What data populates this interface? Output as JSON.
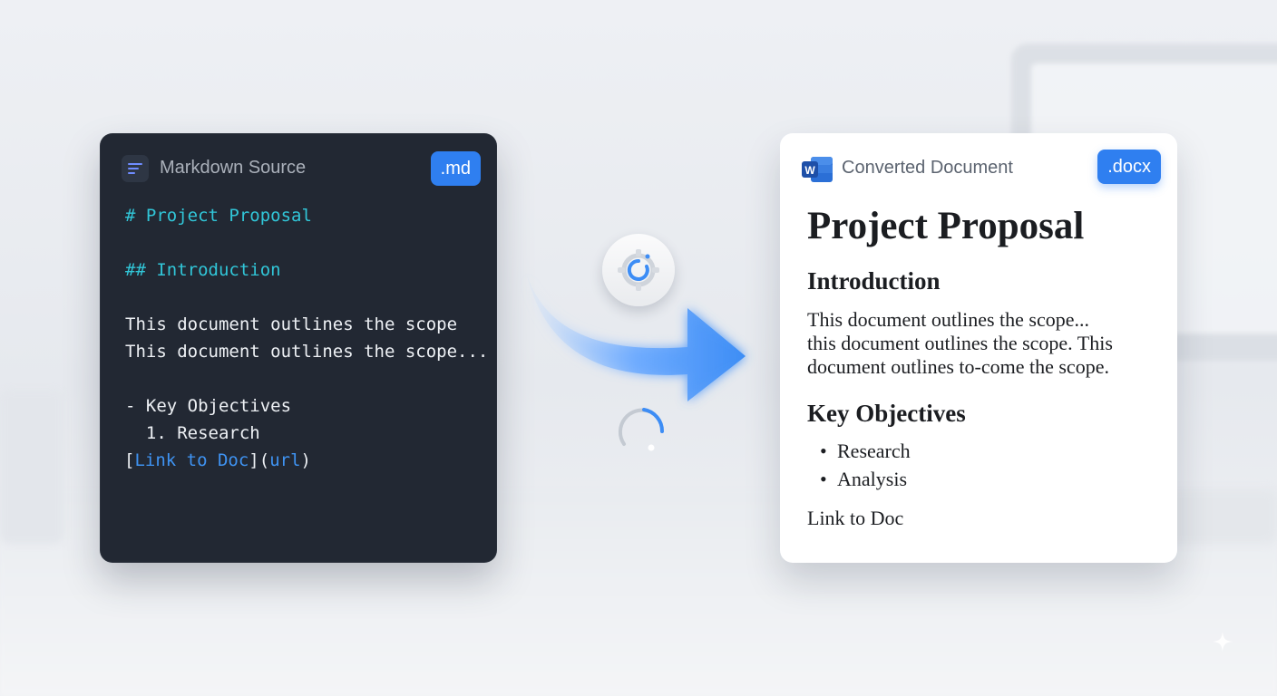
{
  "markdown_panel": {
    "title": "Markdown Source",
    "badge": ".md",
    "icon": "markdown-file-icon",
    "lines": {
      "h1": "# Project Proposal",
      "h2": "## Introduction",
      "p1": "This document outlines the scope",
      "p2": "This document outlines the scope...",
      "li1": "- Key Objectives",
      "li2": "  1. Research",
      "link_open": "[",
      "link_text": "Link to Doc",
      "link_mid": "](",
      "link_url": "url",
      "link_close": ")"
    }
  },
  "conversion": {
    "arrow_icon": "arrow-right-icon",
    "gear_icon": "gear-icon",
    "spinner_icon": "loading-spinner-icon"
  },
  "document_panel": {
    "title": "Converted Document",
    "badge": ".docx",
    "icon": "word-icon",
    "heading": "Project Proposal",
    "section1": "Introduction",
    "paragraph": [
      "This document outlines the scope...",
      "this document outlines the scope. This",
      "document outlines to-come the scope."
    ],
    "section2": "Key Objectives",
    "bullets": [
      "Research",
      "Analysis"
    ],
    "link": "Link to Doc"
  },
  "colors": {
    "accent": "#2f7ff0",
    "code_heading": "#31c6d8",
    "code_link": "#3f93f2",
    "panel_dark": "#222833"
  }
}
